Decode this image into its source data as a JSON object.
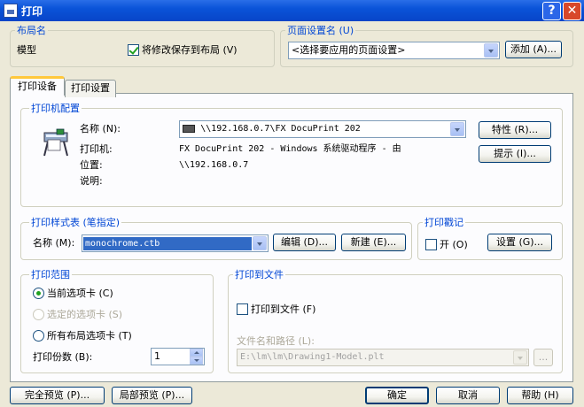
{
  "window": {
    "title": "打印"
  },
  "layout_name": {
    "title": "布局名",
    "value": "模型",
    "save_changes_label": "将修改保存到布局 (V)",
    "save_changes_checked": true
  },
  "page_setup_name": {
    "title": "页面设置名 (U)",
    "selected": "<选择要应用的页面设置>",
    "add_label": "添加 (A)..."
  },
  "tabs": [
    {
      "label": "打印设备",
      "active": true
    },
    {
      "label": "打印设置",
      "active": false
    }
  ],
  "printer_config": {
    "title": "打印机配置",
    "name_label": "名称 (N):",
    "name_value": "\\\\192.168.0.7\\FX DocuPrint 202",
    "printer_label": "打印机:",
    "printer_value": "FX DocuPrint 202 - Windows 系统驱动程序 - 由",
    "location_label": "位置:",
    "location_value": "\\\\192.168.0.7",
    "description_label": "说明:",
    "properties_label": "特性 (R)...",
    "hints_label": "提示 (I)..."
  },
  "plot_style_table": {
    "title": "打印样式表 (笔指定)",
    "name_label": "名称 (M):",
    "name_value": "monochrome.ctb",
    "edit_label": "编辑 (D)...",
    "new_label": "新建 (E)..."
  },
  "plot_stamp": {
    "title": "打印戳记",
    "on_label": "开 (O)",
    "on_checked": false,
    "settings_label": "设置 (G)..."
  },
  "plot_range": {
    "title": "打印范围",
    "options": [
      {
        "label": "当前选项卡 (C)",
        "selected": true,
        "disabled": false
      },
      {
        "label": "选定的选项卡 (S)",
        "selected": false,
        "disabled": true
      },
      {
        "label": "所有布局选项卡 (T)",
        "selected": false,
        "disabled": false
      }
    ],
    "copies_label": "打印份数 (B):",
    "copies_value": "1"
  },
  "plot_to_file": {
    "title": "打印到文件",
    "checkbox_label": "打印到文件 (F)",
    "checked": false,
    "path_label": "文件名和路径 (L):",
    "path_value": "E:\\lm\\lm\\Drawing1-Model.plt",
    "browse_label": "..."
  },
  "footer": {
    "full_preview": "完全预览 (P)...",
    "partial_preview": "局部预览 (P)...",
    "ok": "确定",
    "cancel": "取消",
    "help": "帮助 (H)"
  },
  "colors": {
    "title_bar": "#0a53d8",
    "group_title": "#0046d5",
    "dialog_bg": "#ece9d8",
    "selection": "#316ac5"
  }
}
